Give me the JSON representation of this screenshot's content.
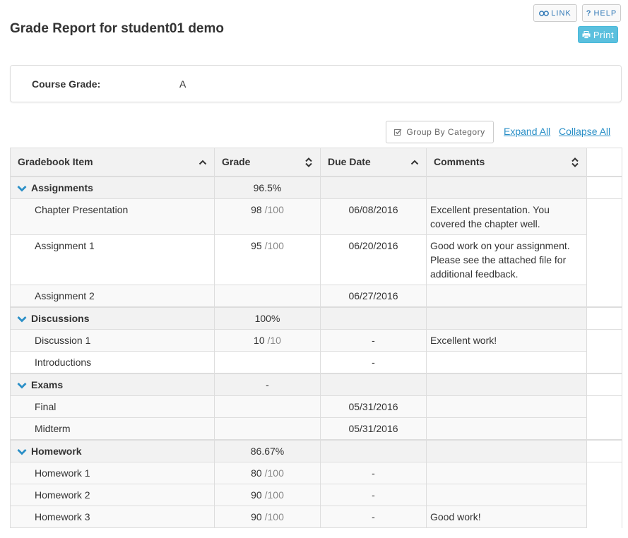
{
  "page": {
    "title": "Grade Report for student01 demo"
  },
  "toolbar": {
    "link_label": "LINK",
    "help_label": "HELP",
    "print_label": "Print"
  },
  "course_grade": {
    "label": "Course Grade:",
    "value": "A"
  },
  "controls": {
    "group_by_label": "Group By Category",
    "expand_all": "Expand All",
    "collapse_all": "Collapse All"
  },
  "table": {
    "headers": [
      "Gradebook Item",
      "Grade",
      "Due Date",
      "Comments"
    ],
    "categories": [
      {
        "name": "Assignments",
        "grade": "96.5%",
        "items": [
          {
            "name": "Chapter Presentation",
            "score": "98",
            "out_of": "/100",
            "due": "06/08/2016",
            "comments": "Excellent presentation. You covered the chapter well."
          },
          {
            "name": "Assignment 1",
            "score": "95",
            "out_of": "/100",
            "due": "06/20/2016",
            "comments": "Good work on your assignment. Please see the attached file for additional feedback."
          },
          {
            "name": "Assignment 2",
            "score": "",
            "out_of": "",
            "due": "06/27/2016",
            "comments": ""
          }
        ]
      },
      {
        "name": "Discussions",
        "grade": "100%",
        "items": [
          {
            "name": "Discussion 1",
            "score": "10",
            "out_of": "/10",
            "due": "-",
            "comments": "Excellent work!"
          },
          {
            "name": "Introductions",
            "score": "",
            "out_of": "",
            "due": "-",
            "comments": ""
          }
        ]
      },
      {
        "name": "Exams",
        "grade": "-",
        "items": [
          {
            "name": "Final",
            "score": "",
            "out_of": "",
            "due": "05/31/2016",
            "comments": ""
          },
          {
            "name": "Midterm",
            "score": "",
            "out_of": "",
            "due": "05/31/2016",
            "comments": ""
          }
        ]
      },
      {
        "name": "Homework",
        "grade": "86.67%",
        "items": [
          {
            "name": "Homework 1",
            "score": "80",
            "out_of": "/100",
            "due": "-",
            "comments": ""
          },
          {
            "name": "Homework 2",
            "score": "90",
            "out_of": "/100",
            "due": "-",
            "comments": ""
          },
          {
            "name": "Homework 3",
            "score": "90",
            "out_of": "/100",
            "due": "-",
            "comments": "Good work!"
          }
        ]
      }
    ]
  },
  "colors": {
    "accent": "#2a8fc7",
    "print_button": "#5bc0de",
    "header_bg": "#f2f2f2",
    "out_of_text": "#888888"
  }
}
